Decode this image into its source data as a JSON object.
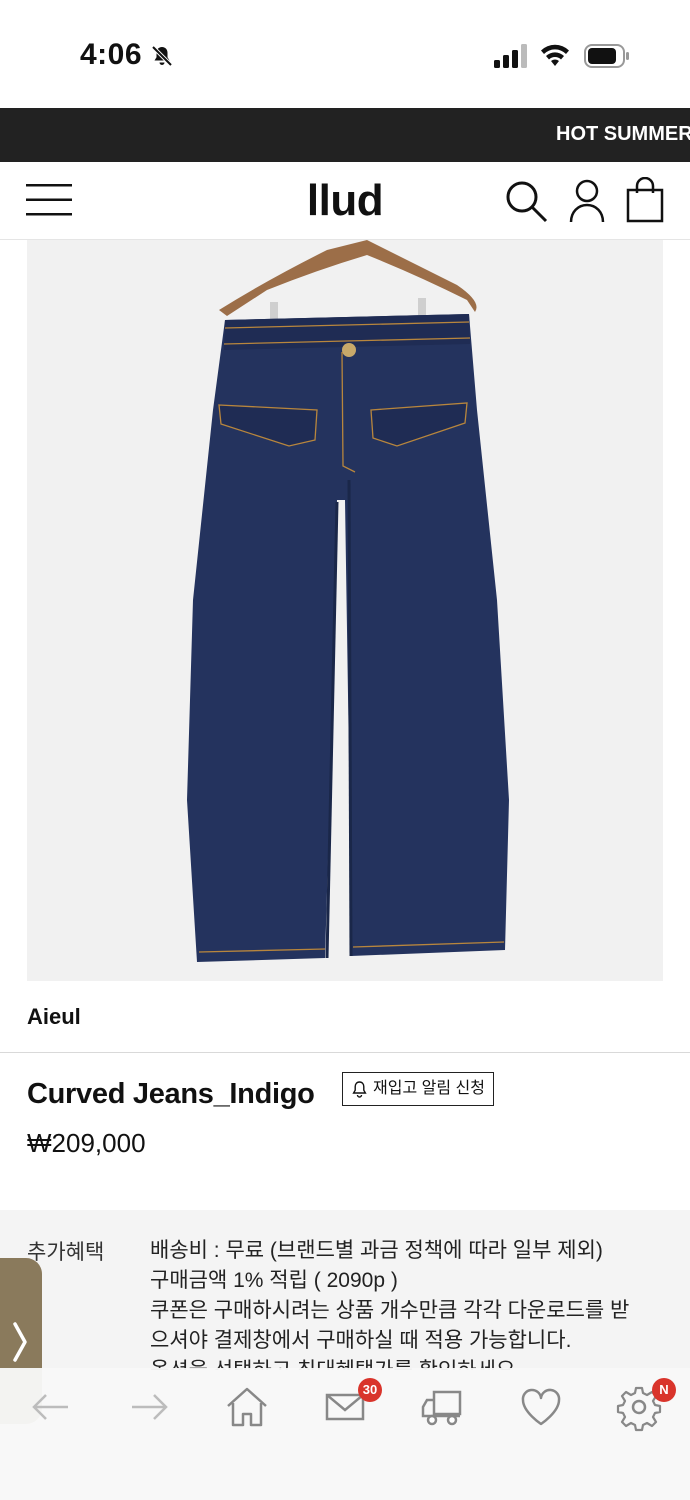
{
  "status_bar": {
    "time": "4:06"
  },
  "promo_banner": {
    "text": "HOT SUMMER"
  },
  "header": {
    "logo": "llud"
  },
  "product": {
    "image_icon": "jeans-on-hanger-photo",
    "brand": "Aieul",
    "name": "Curved Jeans_Indigo",
    "restock_label": "재입고 알림 신청",
    "price": "₩209,000"
  },
  "benefits": {
    "label": "추가혜택",
    "lines": [
      "배송비 : 무료 (브랜드별 과금 정책에 따라 일부 제외)",
      "구매금액 1% 적립 ( 2090p )",
      "쿠폰은 구매하시려는 상품 개수만큼 각각 다운로드를 받",
      "으셔야 결제창에서 구매하실 때 적용 가능합니다.",
      "옵션을 선택하고 최대혜택가를 확인하세요."
    ]
  },
  "toolbar": {
    "mail_badge": "30",
    "settings_badge": "N"
  },
  "colors": {
    "banner_bg": "#222222",
    "side_tab": "#8a7a5c",
    "badge": "#d9342b",
    "denim": "#24335e"
  }
}
